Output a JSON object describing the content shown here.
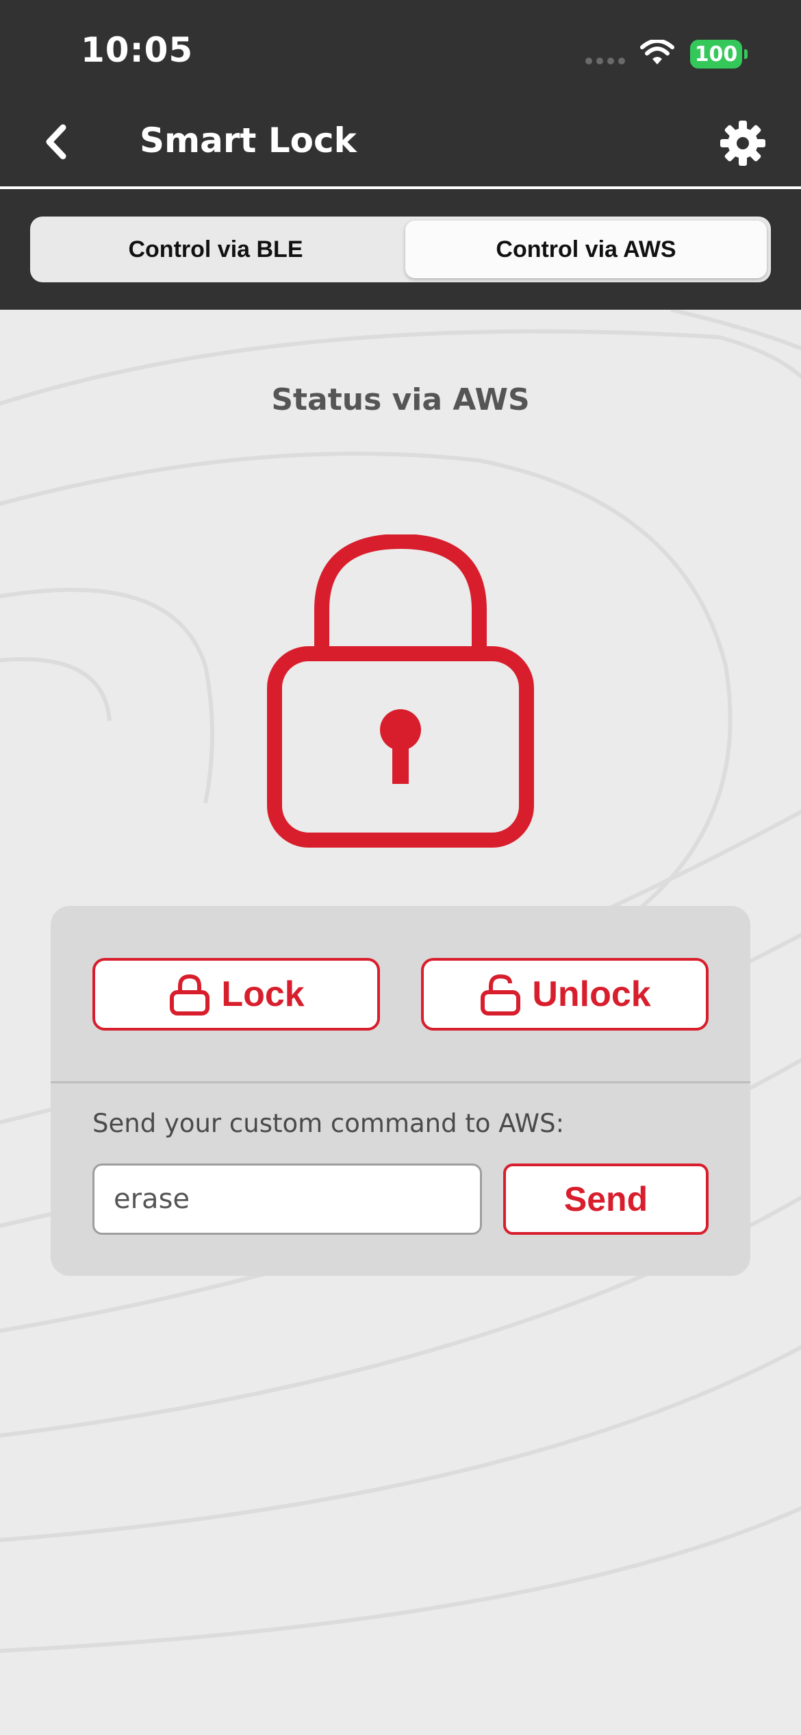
{
  "status_bar": {
    "time": "10:05",
    "battery": "100"
  },
  "nav": {
    "title": "Smart Lock"
  },
  "tabs": [
    {
      "label": "Control via BLE",
      "selected": false
    },
    {
      "label": "Control via AWS",
      "selected": true
    }
  ],
  "status": {
    "title": "Status via AWS",
    "lock_state_icon": "locked-padlock-icon"
  },
  "controls": {
    "lock_label": "Lock",
    "unlock_label": "Unlock",
    "command_prompt": "Send your custom command to AWS:",
    "command_value": "erase",
    "send_label": "Send"
  },
  "colors": {
    "accent": "#d81e2c",
    "header_bg": "#323232",
    "battery": "#34c759"
  }
}
